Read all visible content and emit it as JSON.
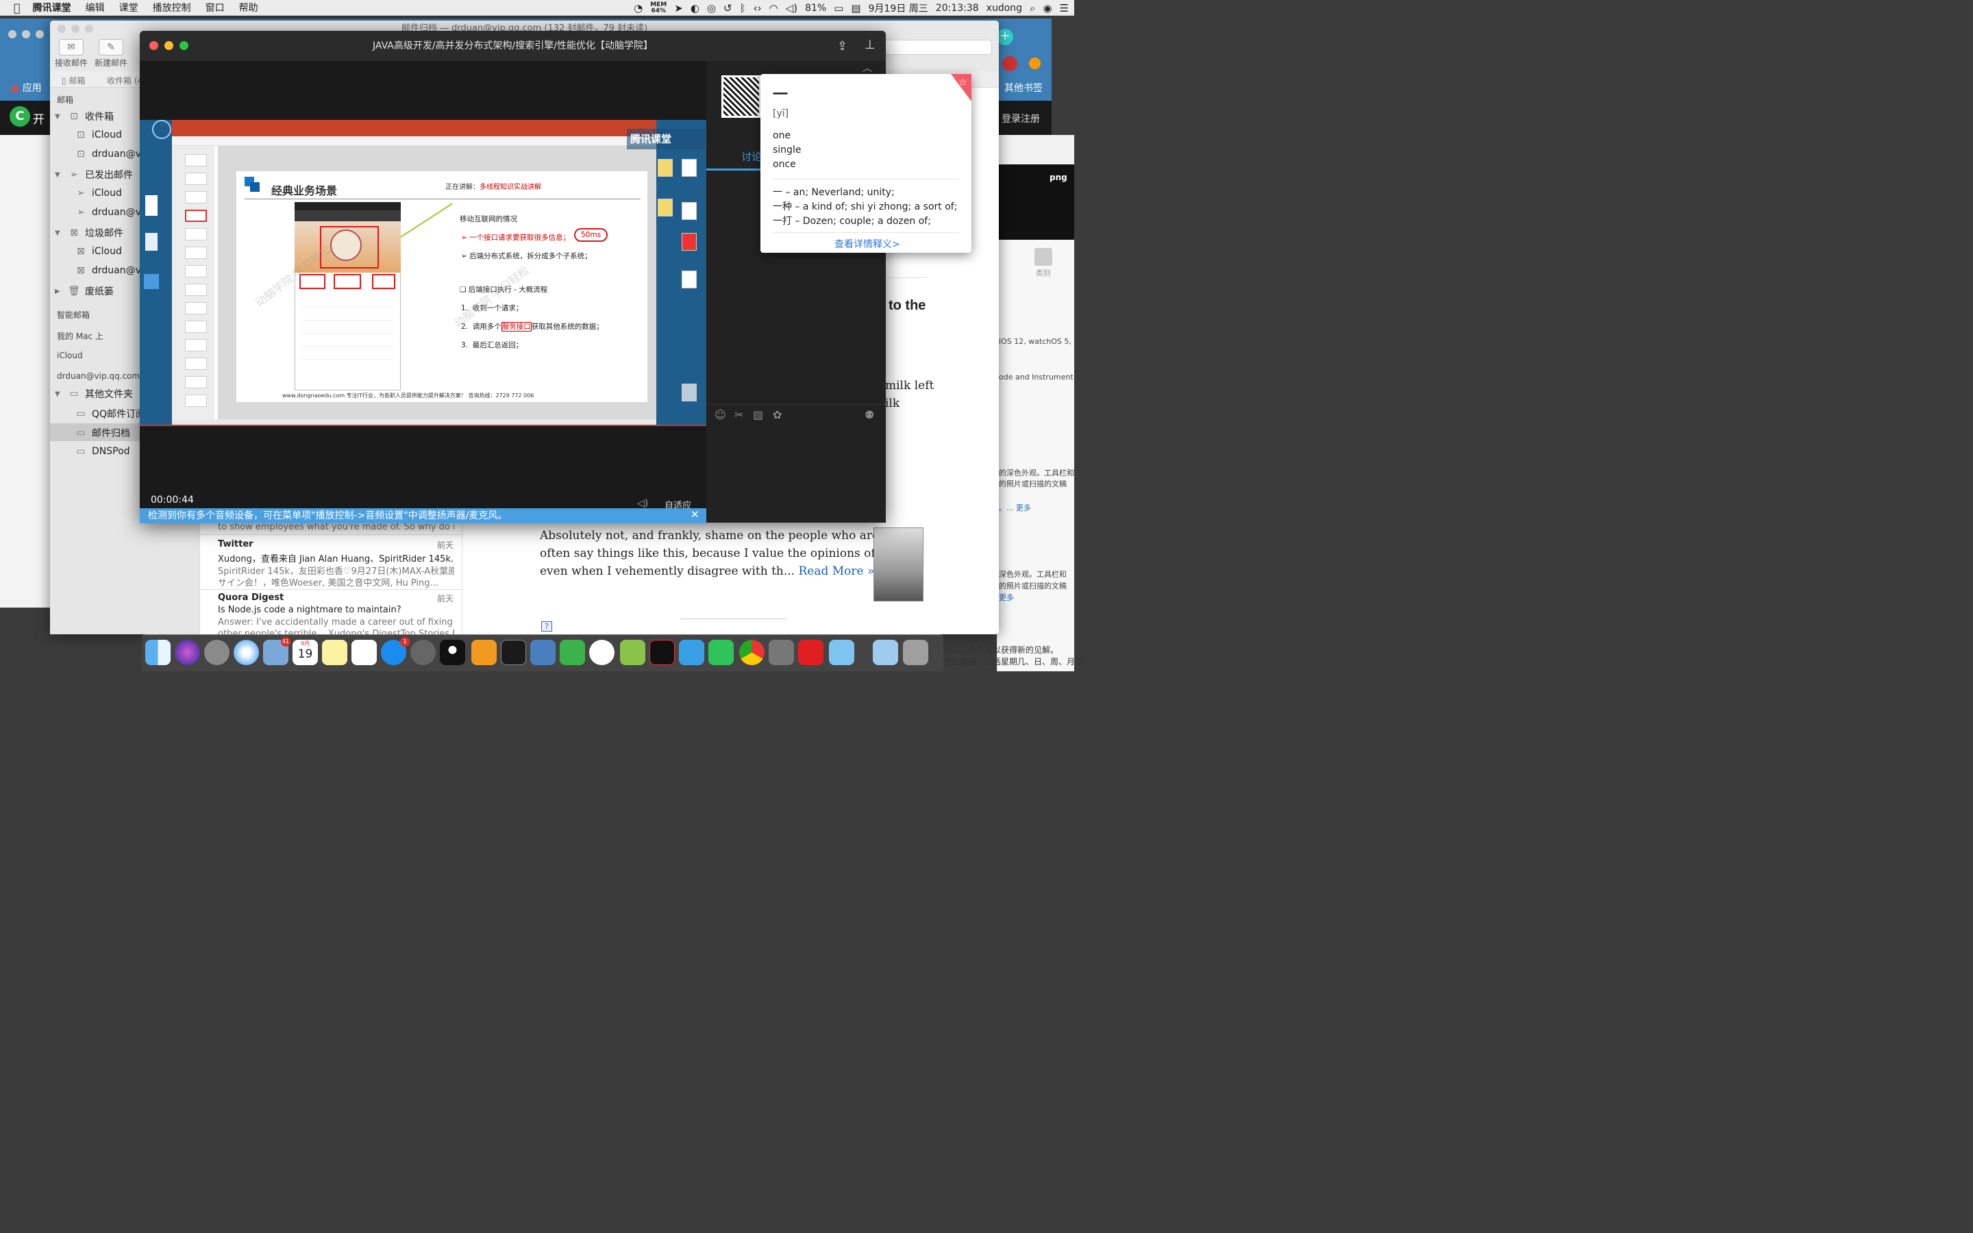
{
  "menubar": {
    "apple": "",
    "items": [
      "腾讯课堂",
      "编辑",
      "课堂",
      "播放控制",
      "窗口",
      "帮助"
    ],
    "mem_label": "MEM",
    "mem_value": "64%",
    "battery": "81%",
    "date": "9月19日 周三",
    "time": "20:13:38",
    "user": "xudong"
  },
  "browser_bg": {
    "apps_label": "应用",
    "other_bookmarks": "其他书签",
    "site_logo_text": "开",
    "login": "登录",
    "register": "注册",
    "png_label": "png",
    "category_label": "类别",
    "right_text": [
      {
        "text": "iOS 12, watchOS 5,"
      },
      {
        "text": "ode and Instrument"
      },
      {
        "text": "的深色外观。工具栏和"
      },
      {
        "text": "的照片或扫描的文稿"
      },
      {
        "text": "。... 更多"
      },
      {
        "text": "深色外观。工具栏和"
      },
      {
        "text": "的照片或扫描的文稿"
      },
      {
        "text": "更多"
      }
    ],
    "bottom_text_1": "理和汇总表格以获得新的见解。",
    "bottom_text_2": "分组数据，包括星期几、日、周、月份"
  },
  "mail": {
    "title": "邮件归档 — drduan@vip.qq.com (132 封邮件，79 封未读)",
    "toolbar": {
      "get_mail": "接收邮件",
      "new_mail": "新建邮件"
    },
    "favorites": {
      "mailboxes": "邮箱",
      "inbox": "收件箱 (4"
    },
    "sidebar": {
      "header": "邮箱",
      "inbox": "收件箱",
      "inbox_icloud": "iCloud",
      "inbox_drduan": "drduan@v",
      "sent": "已发出邮件",
      "sent_icloud": "iCloud",
      "sent_drduan": "drduan@v",
      "junk": "垃圾邮件",
      "junk_icloud": "iCloud",
      "junk_drduan": "drduan@v",
      "trash": "废纸篓",
      "smart": "智能邮箱",
      "onmac": "我的 Mac 上",
      "icloud": "iCloud",
      "account": "drduan@vip.qq.com",
      "other": "其他文件夹",
      "qq": "QQ邮件订阅",
      "archive": "邮件归档",
      "dnspod": "DNSPod"
    },
    "messages": [
      {
        "preview_top": "to show employees what you're made of. So why do mo..."
      },
      {
        "sender": "Twitter",
        "date": "前天",
        "subject": "Xudong，查看来自 Jian Alan Huang、SpiritRider 145k...",
        "preview1": "SpiritRider 145k，友田彩也香♡9月27日(木)MAX-A秋葉原",
        "preview2": "サイン会！，唯色Woeser, 美国之音中文网, Hu Ping..."
      },
      {
        "sender": "Quora Digest",
        "date": "前天",
        "subject": "Is Node.js code a nightmare to maintain?",
        "preview1": "Answer: I've accidentally made a career out of fixing",
        "preview2": "other people's terrible... Xudong's DigestTop Stories For..."
      }
    ],
    "article": {
      "heading_frag": "to the",
      "frag1": "milk left",
      "frag2": "ilk",
      "line1": "Absolutely not, and frankly, shame on the people who are.I don't",
      "line2": "often say things like this, because I value the opinions of others,",
      "line3": "even when I vehemently disagree with th...",
      "read_more": "Read More »",
      "help_icon": "?"
    }
  },
  "video": {
    "title": "JAVA高级开发/高并发分布式架构/搜索引擎/性能优化【动脑学院】",
    "time": "00:00:44",
    "fit": "自适应",
    "notice": "检测到你有多个音频设备，可在菜单项\"播放控制->音频设置\"中调整扬声器/麦克风。",
    "tencent_label": "腾讯课堂",
    "discussion_tab": "讨论",
    "slide": {
      "title": "经典业务场景",
      "now_label": "正在讲解：",
      "now_value": "多线程知识实战讲解",
      "heading": "移动互联网的情况",
      "bullet1_pre": "一个接口请求要获取很多信息；",
      "bullet1_ms": "50ms",
      "bullet2": "后端分布式系统，拆分成多个子系统；",
      "section": "后端接口执行 - 大概流程",
      "step1": "收到一个请求；",
      "step2_pre": "调用多个",
      "step2_red": "服务接口",
      "step2_post": "获取其他系统的数据；",
      "step3": "最后汇总返回；",
      "footer": "www.dongnaoedu.com  专注IT行业，为各职人员提供能力提升解决方案！  咨询热线：2729 772 006",
      "watermark": "动脑学院 学习轻松"
    }
  },
  "dictionary": {
    "word": "一",
    "pinyin": "[yī]",
    "senses": [
      "one",
      "single",
      "once"
    ],
    "phrases": [
      "一 – an; Neverland; unity;",
      "一种 – a kind of; shi yi zhong; a sort of;",
      "一打 – Dozen; couple; a dozen of;"
    ],
    "more": "查看详情释义>"
  },
  "dock": {
    "calendar_day": "19",
    "calendar_month": "9月",
    "mail_badge": "41",
    "appstore_badge": "1"
  }
}
